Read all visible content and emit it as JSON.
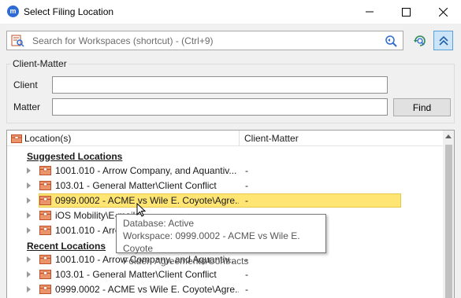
{
  "window": {
    "title": "Select Filing Location",
    "app_icon_glyph": "m",
    "accent_color": "#2e6bd6"
  },
  "search": {
    "placeholder": "Search for Workspaces (shortcut) - (Ctrl+9)"
  },
  "client_matter": {
    "group_label": "Client-Matter",
    "client_label": "Client",
    "client_value": "",
    "matter_label": "Matter",
    "matter_value": "",
    "find_label": "Find"
  },
  "grid": {
    "col_location": "Location(s)",
    "col_client_matter": "Client-Matter",
    "suggested_heading": "Suggested Locations",
    "recent_heading": "Recent Locations",
    "suggested": [
      {
        "name": "1001.010 - Arrow Company, and Aquantiv...",
        "cm": "-",
        "icon": "folder-icon"
      },
      {
        "name": "103.01 - General Matter\\Client Conflict",
        "cm": "-",
        "icon": "folder-icon"
      },
      {
        "name": "0999.0002 - ACME vs Wile E. Coyote\\Agre...",
        "cm": "-",
        "icon": "folder-icon",
        "highlighted": true
      },
      {
        "name": "iOS Mobility\\E-mails",
        "cm": "-",
        "icon": "folder-icon"
      },
      {
        "name": "1001.010 - Arrow Company, and Aquantiv...",
        "cm": "-",
        "icon": "folder-icon"
      }
    ],
    "recent": [
      {
        "name": "1001.010 - Arrow Company, and Aquantiv...",
        "cm": "-",
        "icon": "folder-icon"
      },
      {
        "name": "103.01 - General Matter\\Client Conflict",
        "cm": "-",
        "icon": "folder-icon"
      },
      {
        "name": "0999.0002 - ACME vs Wile E. Coyote\\Agre...",
        "cm": "-",
        "icon": "folder-icon"
      }
    ]
  },
  "tooltip": {
    "line1": "Database: Active",
    "line2": "Workspace: 0999.0002 - ACME vs Wile E. Coyote",
    "line3": "Folder: Agreements/Contracts"
  },
  "colors": {
    "highlight": "#ffe574",
    "folder_icon": "#c0502a"
  }
}
